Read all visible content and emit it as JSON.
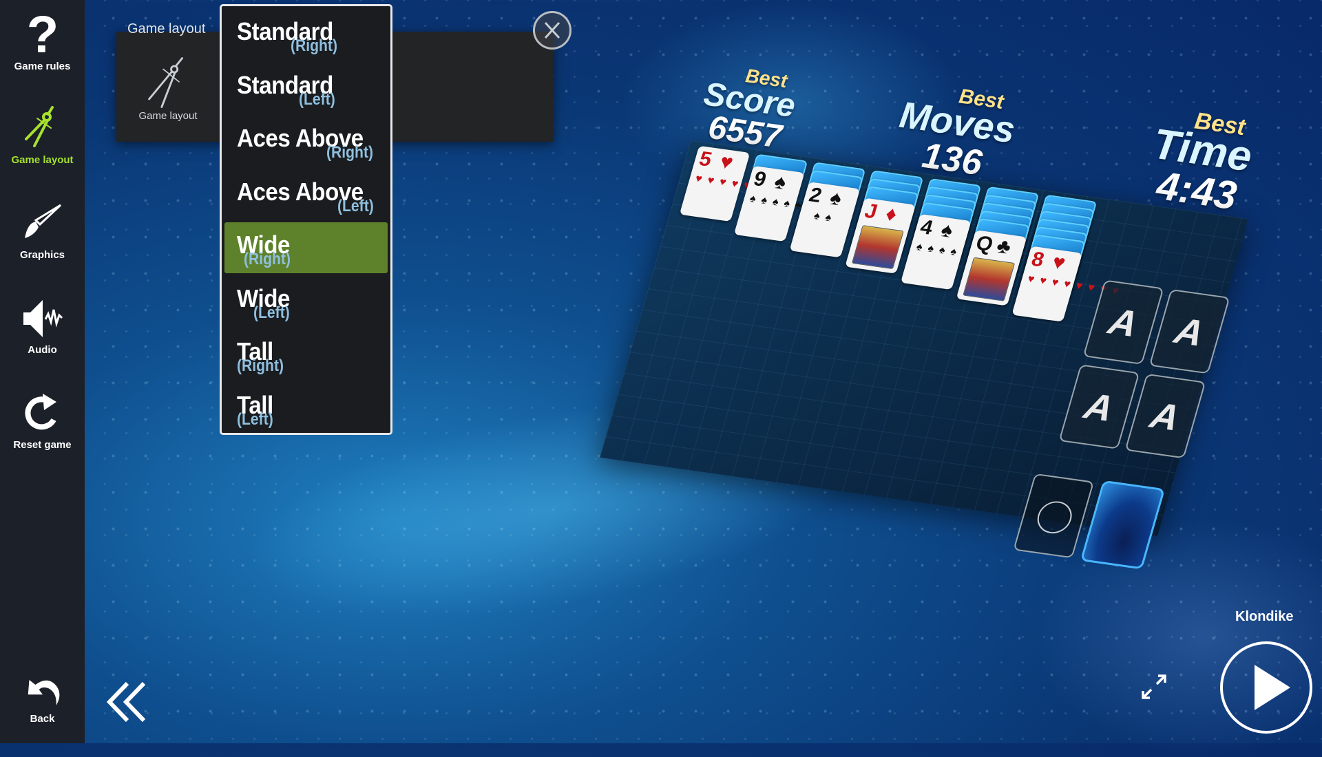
{
  "sidebar": {
    "items": [
      {
        "label": "Game rules",
        "icon": "question-mark-icon",
        "active": false
      },
      {
        "label": "Game layout",
        "icon": "compass-icon",
        "active": true
      },
      {
        "label": "Graphics",
        "icon": "paintbrush-icon",
        "active": false
      },
      {
        "label": "Audio",
        "icon": "speaker-icon",
        "active": false
      },
      {
        "label": "Reset game",
        "icon": "reset-icon",
        "active": false
      }
    ],
    "back_label": "Back"
  },
  "layout_panel": {
    "heading": "Game layout",
    "tile_label": "Game layout"
  },
  "dropdown": {
    "options": [
      {
        "main": "Standard",
        "sub": "(Right)",
        "selected": false
      },
      {
        "main": "Standard",
        "sub": "(Left)",
        "selected": false
      },
      {
        "main": "Aces Above",
        "sub": "(Right)",
        "selected": false
      },
      {
        "main": "Aces Above",
        "sub": "(Left)",
        "selected": false
      },
      {
        "main": "Wide",
        "sub": "(Right)",
        "selected": true
      },
      {
        "main": "Wide",
        "sub": "(Left)",
        "selected": false
      },
      {
        "main": "Tall",
        "sub": "(Right)",
        "selected": false
      },
      {
        "main": "Tall",
        "sub": "(Left)",
        "selected": false
      }
    ],
    "selected_color": "#5e822b"
  },
  "stats": {
    "score": {
      "best": "Best",
      "name": "Score",
      "value": "6557"
    },
    "moves": {
      "best": "Best",
      "name": "Moves",
      "value": "136"
    },
    "time": {
      "best": "Best",
      "name": "Time",
      "value": "4:43"
    }
  },
  "board": {
    "tableau": [
      {
        "hidden": 0,
        "rank": "5",
        "suit": "♥",
        "color": "red"
      },
      {
        "hidden": 1,
        "rank": "9",
        "suit": "♠",
        "color": "black"
      },
      {
        "hidden": 2,
        "rank": "2",
        "suit": "♠",
        "color": "black"
      },
      {
        "hidden": 3,
        "rank": "J",
        "suit": "♦",
        "color": "red"
      },
      {
        "hidden": 4,
        "rank": "4",
        "suit": "♠",
        "color": "black"
      },
      {
        "hidden": 5,
        "rank": "Q",
        "suit": "♣",
        "color": "black"
      },
      {
        "hidden": 6,
        "rank": "8",
        "suit": "♥",
        "color": "red"
      }
    ],
    "foundations": [
      "A",
      "A",
      "A",
      "A"
    ]
  },
  "footer": {
    "game_name": "Klondike"
  },
  "colors": {
    "accent_active": "#a6e22e",
    "best_label": "#ffe28a",
    "subtitle": "#8fbfdf"
  }
}
